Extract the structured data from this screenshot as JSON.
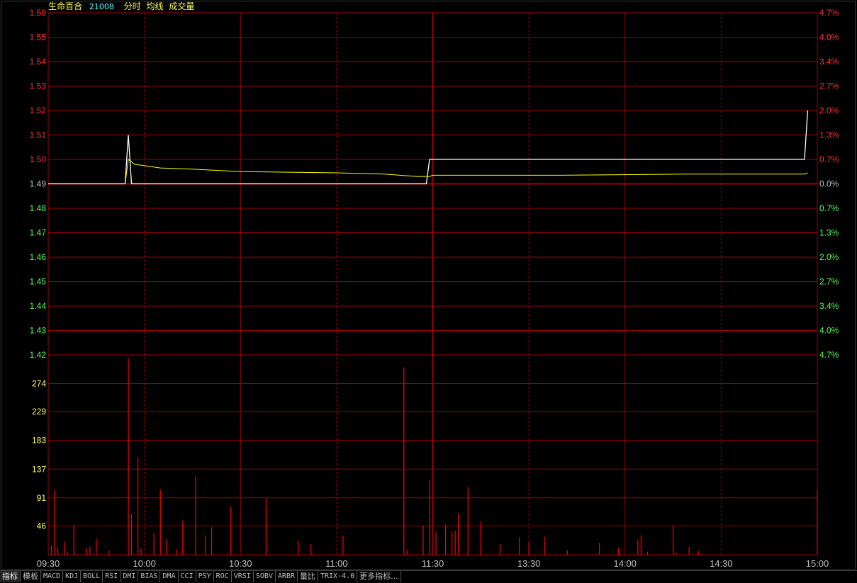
{
  "header": {
    "stock_name": "生命百合",
    "stock_code": "21008",
    "labels": [
      "分时",
      "均线",
      "成交量"
    ]
  },
  "tabs": [
    "指标",
    "模板",
    "MACD",
    "KDJ",
    "BOLL",
    "RSI",
    "DMI",
    "BIAS",
    "DMA",
    "CCI",
    "PSY",
    "ROC",
    "VRSI",
    "SOBV",
    "ARBR",
    "量比",
    "TRIX-4.0",
    "更多指标..."
  ],
  "colors": {
    "background": "#000000",
    "grid": "#a00000",
    "price_line": "#ffffff",
    "avg_line": "#ffff00",
    "volume_bar": "#ff0000",
    "up_text": "#ff3232",
    "down_text": "#54ff54",
    "flat_text": "#c0c0c0",
    "vol_axis_text": "#ffff54"
  },
  "chart_data": [
    {
      "type": "line",
      "prev_close": 1.49,
      "y_ticks": [
        "1.56",
        "1.55",
        "1.54",
        "1.53",
        "1.52",
        "1.51",
        "1.50",
        "1.49",
        "1.48",
        "1.47",
        "1.46",
        "1.45",
        "1.44",
        "1.43",
        "1.42"
      ],
      "pct_ticks": [
        "4.7%",
        "4.0%",
        "3.4%",
        "2.7%",
        "2.0%",
        "1.3%",
        "0.7%",
        "0.0%",
        "0.7%",
        "1.3%",
        "2.0%",
        "2.7%",
        "3.4%",
        "4.0%",
        "4.7%"
      ],
      "x_ticks": [
        "09:30",
        "10:00",
        "10:30",
        "11:00",
        "11:30",
        "13:30",
        "14:00",
        "14:30",
        "15:00"
      ],
      "ylim": [
        1.42,
        1.56
      ],
      "series": [
        {
          "name": "分时",
          "points": [
            [
              0,
              1.49
            ],
            [
              24,
              1.49
            ],
            [
              25,
              1.51
            ],
            [
              26,
              1.49
            ],
            [
              118,
              1.49
            ],
            [
              119,
              1.5
            ],
            [
              236,
              1.5
            ],
            [
              237,
              1.52
            ]
          ]
        },
        {
          "name": "均线",
          "points": [
            [
              0,
              1.49
            ],
            [
              24,
              1.49
            ],
            [
              25,
              1.5
            ],
            [
              27,
              1.498
            ],
            [
              35,
              1.4965
            ],
            [
              45,
              1.496
            ],
            [
              60,
              1.495
            ],
            [
              90,
              1.4945
            ],
            [
              105,
              1.494
            ],
            [
              115,
              1.493
            ],
            [
              119,
              1.493
            ],
            [
              120,
              1.4935
            ],
            [
              160,
              1.4935
            ],
            [
              200,
              1.494
            ],
            [
              236,
              1.494
            ],
            [
              237,
              1.4945
            ]
          ]
        }
      ]
    },
    {
      "type": "bar",
      "y_ticks": [
        "274",
        "229",
        "183",
        "137",
        "91",
        "46"
      ],
      "ylim": [
        0,
        320
      ],
      "bars": [
        [
          1,
          15
        ],
        [
          2,
          104
        ],
        [
          3,
          12
        ],
        [
          5,
          21
        ],
        [
          6,
          5
        ],
        [
          8,
          47
        ],
        [
          12,
          10
        ],
        [
          13,
          13
        ],
        [
          15,
          26
        ],
        [
          19,
          7
        ],
        [
          25,
          315
        ],
        [
          26,
          65
        ],
        [
          28,
          155
        ],
        [
          29,
          10
        ],
        [
          33,
          35
        ],
        [
          35,
          104
        ],
        [
          37,
          25
        ],
        [
          40,
          8
        ],
        [
          42,
          55
        ],
        [
          46,
          125
        ],
        [
          49,
          31
        ],
        [
          51,
          44
        ],
        [
          57,
          77
        ],
        [
          68,
          90
        ],
        [
          78,
          22
        ],
        [
          82,
          17
        ],
        [
          92,
          30
        ],
        [
          111,
          300
        ],
        [
          112,
          8
        ],
        [
          117,
          47
        ],
        [
          119,
          120
        ],
        [
          121,
          36
        ],
        [
          124,
          48
        ],
        [
          126,
          37
        ],
        [
          127,
          38
        ],
        [
          128,
          66
        ],
        [
          131,
          108
        ],
        [
          135,
          53
        ],
        [
          141,
          17
        ],
        [
          147,
          28
        ],
        [
          150,
          20
        ],
        [
          155,
          29
        ],
        [
          162,
          7
        ],
        [
          172,
          19
        ],
        [
          178,
          12
        ],
        [
          184,
          24
        ],
        [
          185,
          31
        ],
        [
          187,
          5
        ],
        [
          195,
          47
        ],
        [
          196,
          3
        ],
        [
          200,
          13
        ],
        [
          203,
          6
        ],
        [
          240,
          104
        ]
      ]
    }
  ]
}
